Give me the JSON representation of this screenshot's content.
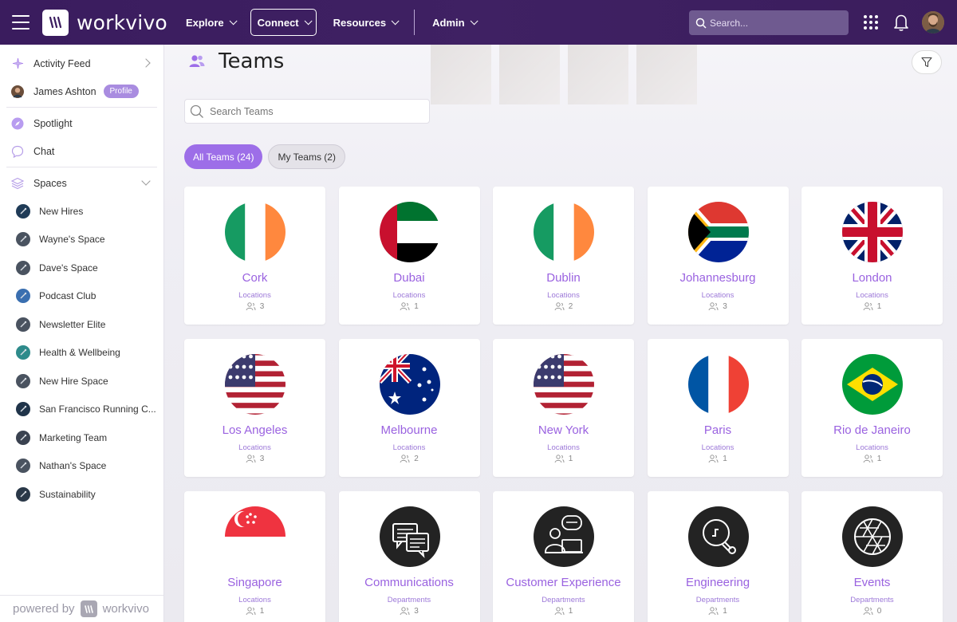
{
  "topbar": {
    "logo_text": "workvivo",
    "nav": [
      {
        "label": "Explore"
      },
      {
        "label": "Connect"
      },
      {
        "label": "Resources"
      },
      {
        "label": "Admin"
      }
    ],
    "search_placeholder": "Search..."
  },
  "sidebar": {
    "activity_feed": "Activity Feed",
    "user_name": "James Ashton",
    "profile_badge": "Profile",
    "spotlight": "Spotlight",
    "chat": "Chat",
    "spaces": "Spaces",
    "space_items": [
      {
        "label": "New Hires"
      },
      {
        "label": "Wayne's Space"
      },
      {
        "label": "Dave's Space"
      },
      {
        "label": "Podcast Club"
      },
      {
        "label": "Newsletter Elite"
      },
      {
        "label": "Health & Wellbeing"
      },
      {
        "label": "New Hire Space"
      },
      {
        "label": "San Francisco Running C..."
      },
      {
        "label": "Marketing Team"
      },
      {
        "label": "Nathan's Space"
      },
      {
        "label": "Sustainability"
      }
    ],
    "powered_by": "powered by",
    "powered_logo": "workvivo"
  },
  "main": {
    "title": "Teams",
    "search_placeholder": "Search Teams",
    "tabs": [
      {
        "label": "All Teams (24)"
      },
      {
        "label": "My Teams (2)"
      }
    ],
    "teams": [
      {
        "name": "Cork",
        "category": "Locations",
        "members": "3",
        "image": "ireland-flag"
      },
      {
        "name": "Dubai",
        "category": "Locations",
        "members": "1",
        "image": "uae-flag"
      },
      {
        "name": "Dublin",
        "category": "Locations",
        "members": "2",
        "image": "ireland-flag"
      },
      {
        "name": "Johannesburg",
        "category": "Locations",
        "members": "3",
        "image": "south-africa-flag"
      },
      {
        "name": "London",
        "category": "Locations",
        "members": "1",
        "image": "uk-flag"
      },
      {
        "name": "Los Angeles",
        "category": "Locations",
        "members": "3",
        "image": "usa-flag"
      },
      {
        "name": "Melbourne",
        "category": "Locations",
        "members": "2",
        "image": "australia-flag"
      },
      {
        "name": "New York",
        "category": "Locations",
        "members": "1",
        "image": "usa-flag"
      },
      {
        "name": "Paris",
        "category": "Locations",
        "members": "1",
        "image": "france-flag"
      },
      {
        "name": "Rio de Janeiro",
        "category": "Locations",
        "members": "1",
        "image": "brazil-flag"
      },
      {
        "name": "Singapore",
        "category": "Locations",
        "members": "1",
        "image": "singapore-flag"
      },
      {
        "name": "Communications",
        "category": "Departments",
        "members": "3",
        "image": "chat-bubbles-icon"
      },
      {
        "name": "Customer Experience",
        "category": "Departments",
        "members": "1",
        "image": "support-agent-icon"
      },
      {
        "name": "Engineering",
        "category": "Departments",
        "members": "1",
        "image": "lightbulb-icon"
      },
      {
        "name": "Events",
        "category": "Departments",
        "members": "0",
        "image": "camera-aperture-icon"
      }
    ]
  },
  "colors": {
    "topbar": "#3f2163",
    "accent": "#9d6ee8",
    "team_name": "#9a62e0"
  }
}
